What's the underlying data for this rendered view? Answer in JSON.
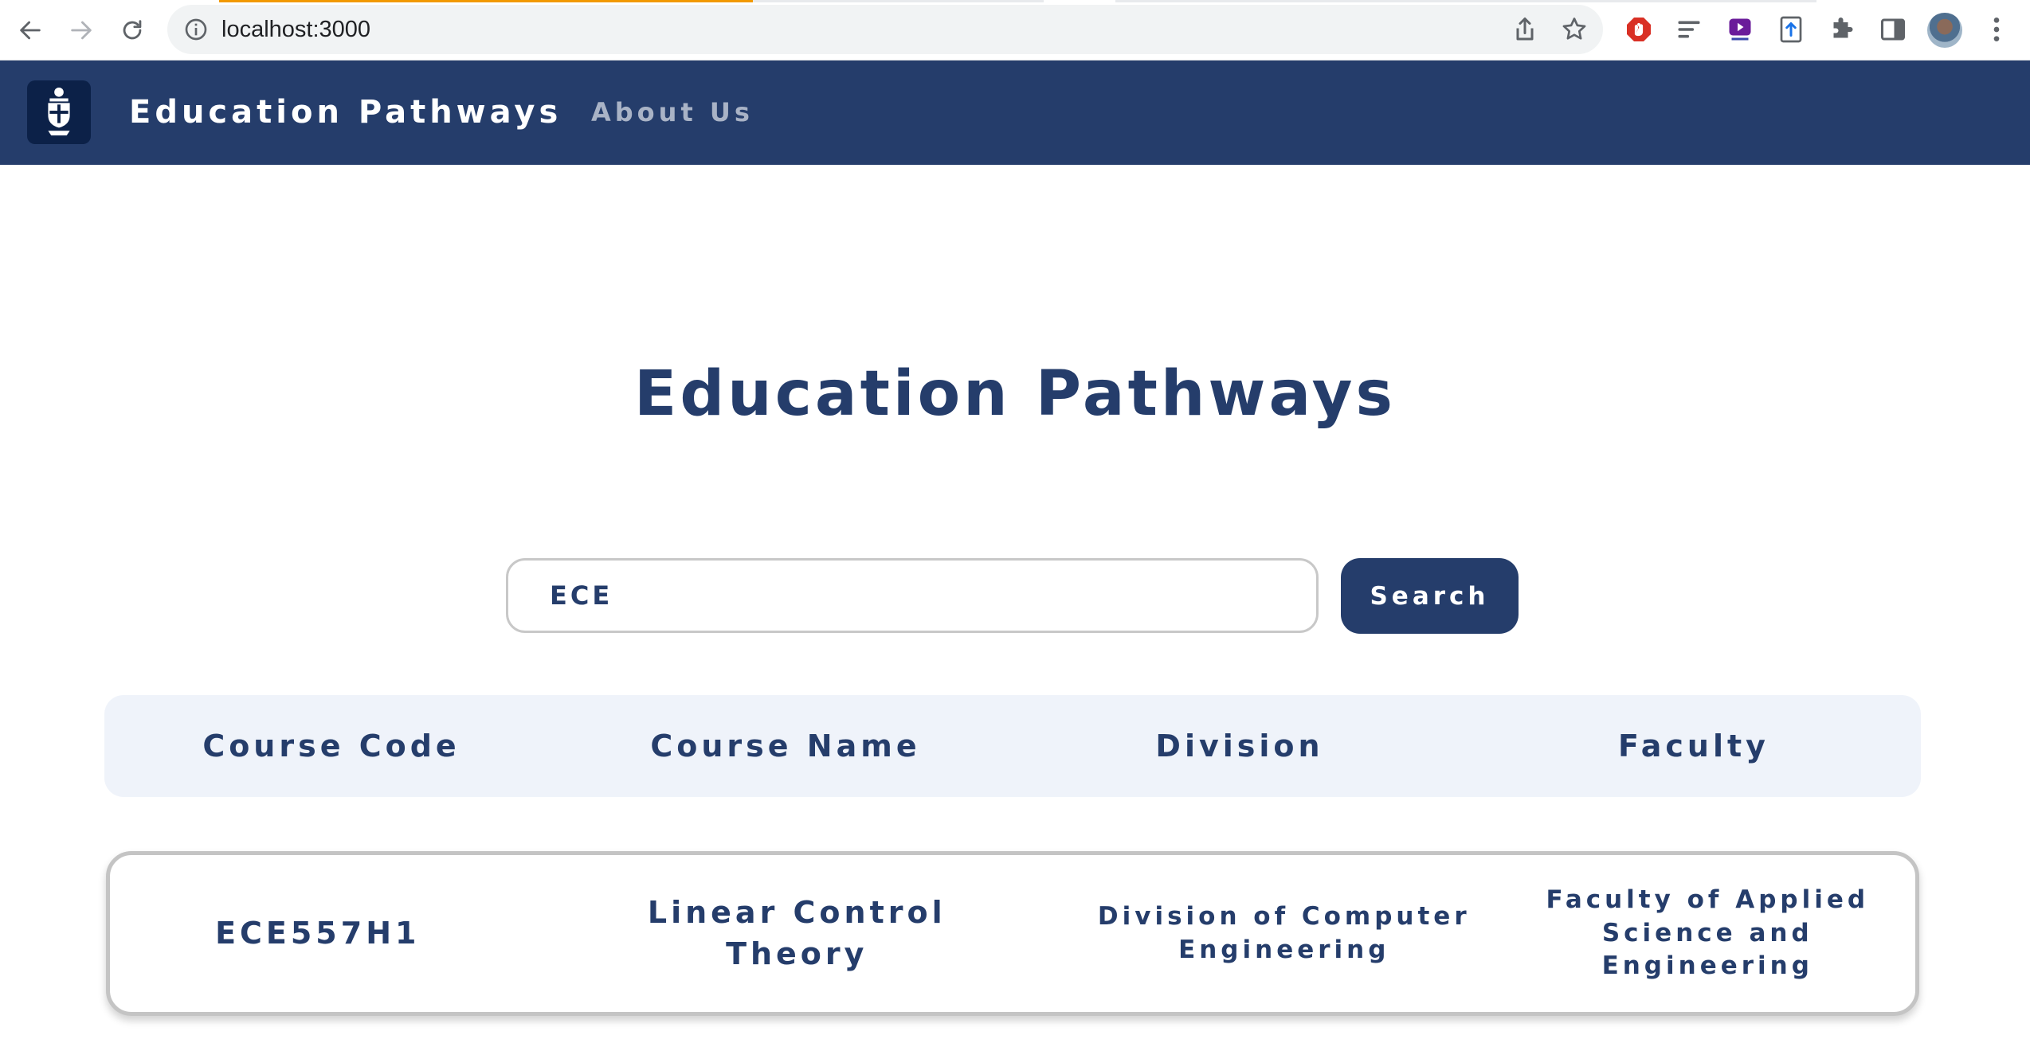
{
  "browser": {
    "url": "localhost:3000",
    "icons": {
      "back": "arrow-left-icon",
      "forward": "arrow-right-icon",
      "reload": "reload-icon",
      "site_info": "info-icon",
      "share": "share-icon",
      "bookmark": "star-icon",
      "extensions": [
        "adblock-icon",
        "lines-icon",
        "speed-icon",
        "upload-icon",
        "puzzle-icon",
        "side-panel-icon"
      ],
      "menu": "kebab-icon"
    }
  },
  "navbar": {
    "brand": "Education Pathways",
    "links": [
      {
        "label": "About Us"
      }
    ],
    "background": "#253d6b"
  },
  "main": {
    "title": "Education Pathways",
    "search": {
      "value": "ECE",
      "button_label": "Search"
    },
    "table": {
      "headers": [
        "Course Code",
        "Course Name",
        "Division",
        "Faculty"
      ],
      "rows": [
        {
          "code": "ECE557H1",
          "name": "Linear Control Theory",
          "division": "Division of Computer Engineering",
          "faculty": "Faculty of Applied Science and Engineering"
        }
      ]
    }
  },
  "colors": {
    "primary": "#253d6b",
    "header_bg": "#eff3fa",
    "muted_link": "#a9b3c6"
  }
}
